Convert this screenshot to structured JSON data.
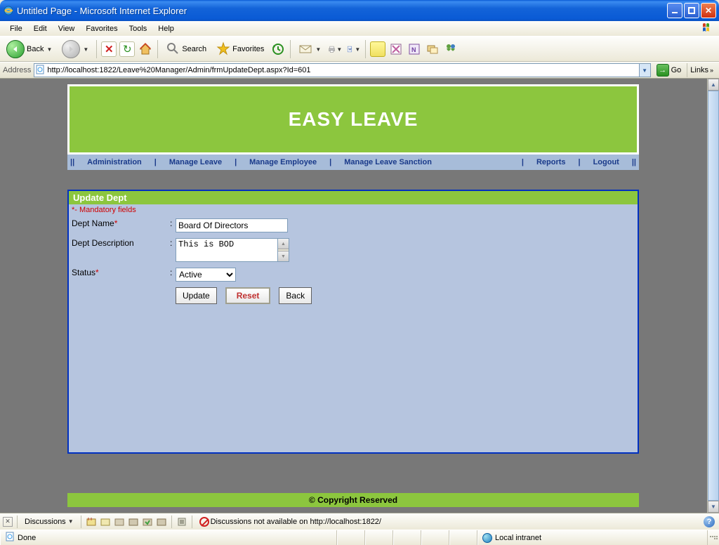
{
  "window": {
    "title": "Untitled Page - Microsoft Internet Explorer"
  },
  "menubar": [
    "File",
    "Edit",
    "View",
    "Favorites",
    "Tools",
    "Help"
  ],
  "toolbar": {
    "back": "Back",
    "search": "Search",
    "favorites": "Favorites"
  },
  "addressbar": {
    "label": "Address",
    "url": "http://localhost:1822/Leave%20Manager/Admin/frmUpdateDept.aspx?Id=601",
    "go": "Go",
    "links": "Links"
  },
  "app": {
    "banner": "EASY LEAVE",
    "nav": [
      "Administration",
      "Manage Leave",
      "Manage Employee",
      "Manage Leave Sanction",
      "Reports",
      "Logout"
    ],
    "panel_title": "Update Dept",
    "mandatory_note": "*- Mandatory fields",
    "fields": {
      "dept_name_label": "Dept Name",
      "dept_name_value": "Board Of Directors",
      "dept_desc_label": "Dept Description",
      "dept_desc_value": "This is BOD",
      "status_label": "Status",
      "status_value": "Active"
    },
    "buttons": {
      "update": "Update",
      "reset": "Reset",
      "back": "Back"
    },
    "footer": "© Copyright Reserved"
  },
  "discussions": {
    "label": "Discussions",
    "message": "Discussions not available on http://localhost:1822/"
  },
  "statusbar": {
    "done": "Done",
    "zone": "Local intranet"
  }
}
